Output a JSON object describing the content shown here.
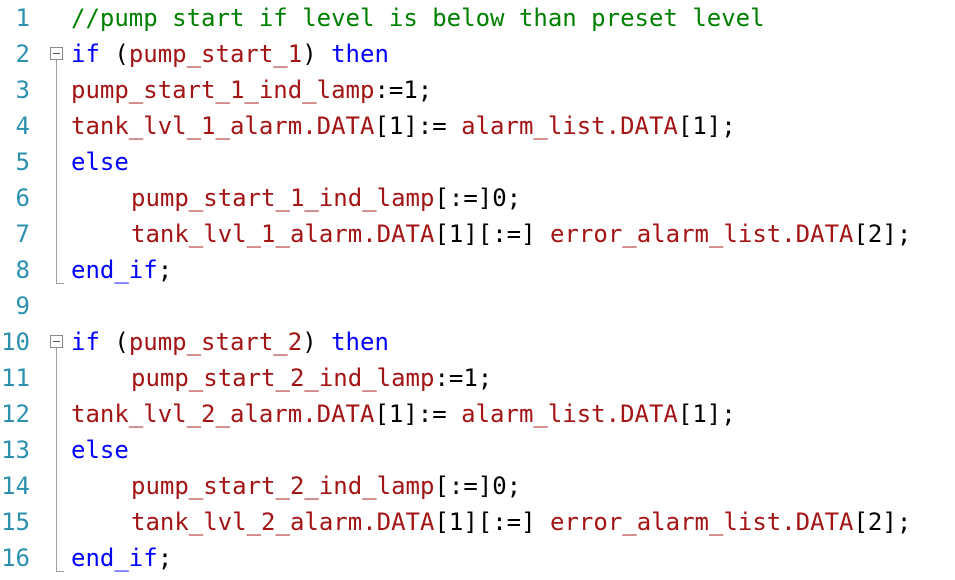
{
  "editor": {
    "colors": {
      "line_number": "#2b91af",
      "comment": "#008000",
      "keyword": "#0000ff",
      "identifier": "#a31515",
      "plain": "#000000"
    },
    "lines": [
      {
        "n": "1",
        "tokens": [
          {
            "t": "//pump start if level is below than preset level",
            "k": "comment"
          }
        ]
      },
      {
        "n": "2",
        "tokens": [
          {
            "t": "if",
            "k": "kw"
          },
          {
            "t": " (",
            "k": "plain"
          },
          {
            "t": "pump_start_1",
            "k": "id"
          },
          {
            "t": ") ",
            "k": "plain"
          },
          {
            "t": "then",
            "k": "kw"
          }
        ]
      },
      {
        "n": "3",
        "tokens": [
          {
            "t": "pump_start_1_ind_lamp",
            "k": "id"
          },
          {
            "t": ":=1;",
            "k": "plain"
          }
        ]
      },
      {
        "n": "4",
        "tokens": [
          {
            "t": "tank_lvl_1_alarm.DATA",
            "k": "id"
          },
          {
            "t": "[1]:= ",
            "k": "plain"
          },
          {
            "t": "alarm_list.DATA",
            "k": "id"
          },
          {
            "t": "[1];",
            "k": "plain"
          }
        ]
      },
      {
        "n": "5",
        "tokens": [
          {
            "t": "else",
            "k": "kw"
          }
        ]
      },
      {
        "n": "6",
        "indent": true,
        "tokens": [
          {
            "t": "pump_start_1_ind_lamp",
            "k": "id"
          },
          {
            "t": "[:=]0;",
            "k": "plain"
          }
        ]
      },
      {
        "n": "7",
        "indent": true,
        "tokens": [
          {
            "t": "tank_lvl_1_alarm.DATA",
            "k": "id"
          },
          {
            "t": "[1][:=] ",
            "k": "plain"
          },
          {
            "t": "error_alarm_list.DATA",
            "k": "id"
          },
          {
            "t": "[2];",
            "k": "plain"
          }
        ]
      },
      {
        "n": "8",
        "tokens": [
          {
            "t": "end_if",
            "k": "kw"
          },
          {
            "t": ";",
            "k": "plain"
          }
        ]
      },
      {
        "n": "9",
        "tokens": []
      },
      {
        "n": "10",
        "tokens": [
          {
            "t": "if",
            "k": "kw"
          },
          {
            "t": " (",
            "k": "plain"
          },
          {
            "t": "pump_start_2",
            "k": "id"
          },
          {
            "t": ") ",
            "k": "plain"
          },
          {
            "t": "then",
            "k": "kw"
          }
        ]
      },
      {
        "n": "11",
        "indent": true,
        "tokens": [
          {
            "t": "pump_start_2_ind_lamp",
            "k": "id"
          },
          {
            "t": ":=1;",
            "k": "plain"
          }
        ]
      },
      {
        "n": "12",
        "tokens": [
          {
            "t": "tank_lvl_2_alarm.DATA",
            "k": "id"
          },
          {
            "t": "[1]:= ",
            "k": "plain"
          },
          {
            "t": "alarm_list.DATA",
            "k": "id"
          },
          {
            "t": "[1];",
            "k": "plain"
          }
        ]
      },
      {
        "n": "13",
        "tokens": [
          {
            "t": "else",
            "k": "kw"
          }
        ]
      },
      {
        "n": "14",
        "indent": true,
        "tokens": [
          {
            "t": "pump_start_2_ind_lamp",
            "k": "id"
          },
          {
            "t": "[:=]0;",
            "k": "plain"
          }
        ]
      },
      {
        "n": "15",
        "indent": true,
        "tokens": [
          {
            "t": "tank_lvl_2_alarm.DATA",
            "k": "id"
          },
          {
            "t": "[1][:=] ",
            "k": "plain"
          },
          {
            "t": "error_alarm_list.DATA",
            "k": "id"
          },
          {
            "t": "[2];",
            "k": "plain"
          }
        ]
      },
      {
        "n": "16",
        "tokens": [
          {
            "t": "end_if",
            "k": "kw"
          },
          {
            "t": ";",
            "k": "plain"
          }
        ]
      }
    ],
    "folds": [
      {
        "start": "2",
        "end": "8",
        "state": "expanded"
      },
      {
        "start": "10",
        "end": "16",
        "state": "expanded"
      }
    ]
  }
}
